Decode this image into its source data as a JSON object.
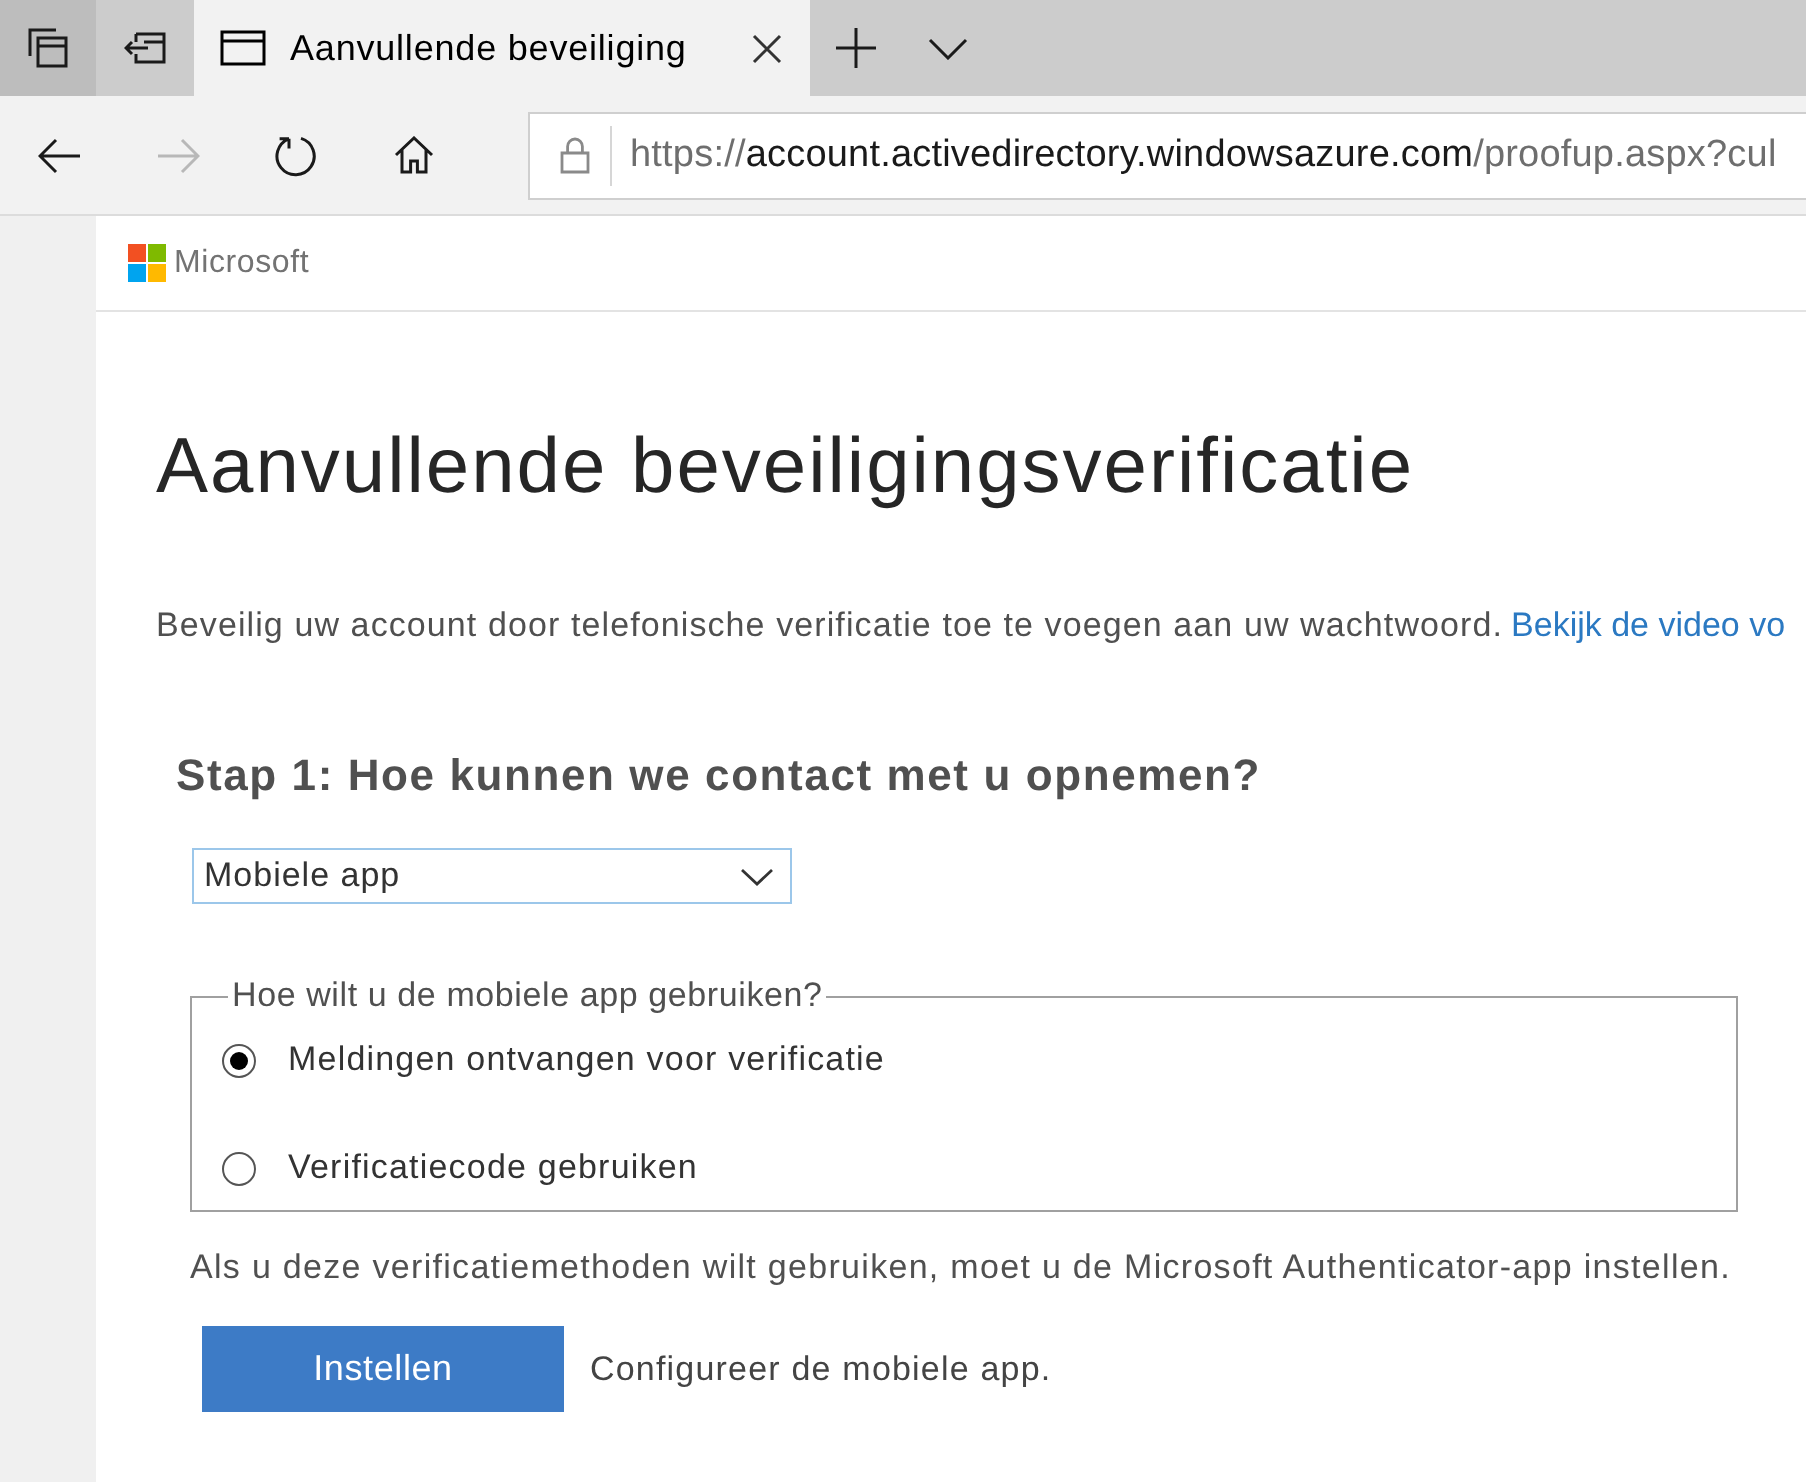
{
  "browser": {
    "tabs": [
      {
        "title": "Aanvullende beveiliging",
        "selected": true
      }
    ],
    "nav_buttons": [
      {
        "kind": "back",
        "disabled": false
      },
      {
        "kind": "forward",
        "disabled": true
      },
      {
        "kind": "refresh",
        "disabled": false
      },
      {
        "kind": "home",
        "disabled": false
      }
    ],
    "address": {
      "scheme": "https://",
      "host": "account.activedirectory.windowsazure.com",
      "path": "/proofup.aspx?cul"
    }
  },
  "header": {
    "brand": "Microsoft"
  },
  "page": {
    "title": "Aanvullende beveiligingsverificatie",
    "intro": "Beveilig uw account door telefonische verificatie toe te voegen aan uw wachtwoord.",
    "intro_link": "Bekijk de video vo",
    "step_heading": "Stap 1: Hoe kunnen we contact met u opnemen?",
    "method_select": {
      "value": "Mobiele app"
    },
    "usage_group": {
      "legend": "Hoe wilt u de mobiele app gebruiken?",
      "options": [
        {
          "label": "Meldingen ontvangen voor verificatie",
          "selected": true
        },
        {
          "label": "Verificatiecode gebruiken",
          "selected": false
        }
      ]
    },
    "note": "Als u deze verificatiemethoden wilt gebruiken, moet u de Microsoft Authenticator-app instellen.",
    "setup_button": "Instellen",
    "setup_hint": "Configureer de mobiele app."
  }
}
